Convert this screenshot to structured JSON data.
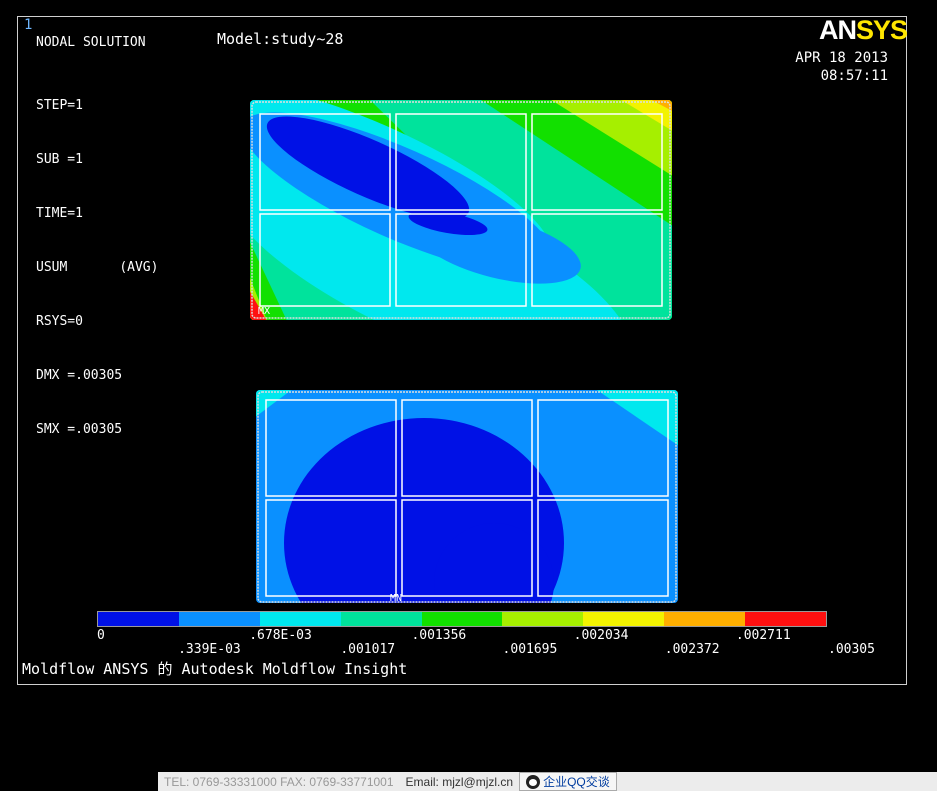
{
  "window_number": "1",
  "header": {
    "title": "NODAL SOLUTION",
    "model": "Model:study~28",
    "step": "STEP=1",
    "sub": "SUB =1",
    "time": "TIME=1",
    "usum": "USUM",
    "avg": "(AVG)",
    "rsys": "RSYS=0",
    "dmx": "DMX =.00305",
    "smx": "SMX =.00305"
  },
  "date": {
    "day": "APR 18 2013",
    "time": "08:57:11"
  },
  "logo": {
    "an": "AN",
    "sys": "SYS"
  },
  "plot_labels": {
    "max_label": "MX",
    "min_label": "MN"
  },
  "legend": {
    "colors": [
      "#0011e6",
      "#0a90ff",
      "#00e8ee",
      "#00e39c",
      "#12e000",
      "#a6ef00",
      "#f3f300",
      "#ffaf00",
      "#ff1010"
    ],
    "upper_ticks": [
      "0",
      ".678E-03",
      ".001356",
      ".002034",
      ".002711"
    ],
    "lower_ticks": [
      ".339E-03",
      ".001017",
      ".001695",
      ".002372",
      ".00305"
    ]
  },
  "footer": "Moldflow ANSYS 的 Autodesk Moldflow Insight",
  "statusbar": {
    "text1": "TEL: 0769-33331000 FAX: 0769-33771001",
    "email": "Email: mjzl@mjzl.cn",
    "qq": "企业QQ交谈"
  }
}
